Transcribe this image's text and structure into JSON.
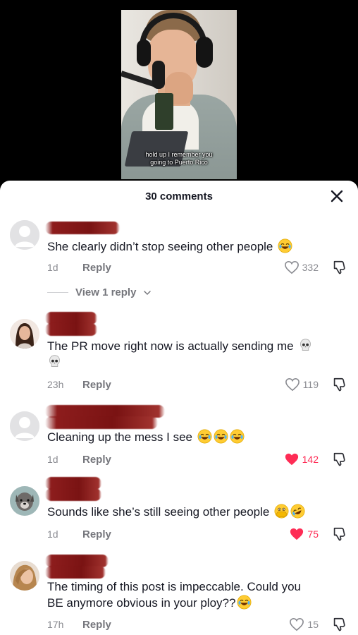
{
  "video": {
    "caption_line1": "hold up I remember you",
    "caption_line2": "going to Puerto Rico"
  },
  "sheet": {
    "comment_count": "30 comments"
  },
  "comments": [
    {
      "text": "She clearly didn’t stop seeing other people",
      "time": "1d",
      "reply_label": "Reply",
      "likes": "332",
      "liked": false,
      "emojis": [
        "joy-emoji"
      ]
    },
    {
      "text": "The PR move right now is actually sending me",
      "time": "23h",
      "reply_label": "Reply",
      "likes": "119",
      "liked": false,
      "emojis": [
        "skull-emoji",
        "skull-emoji"
      ]
    },
    {
      "text": "Cleaning up the mess I see",
      "time": "1d",
      "reply_label": "Reply",
      "likes": "142",
      "liked": true,
      "emojis": [
        "joy-emoji",
        "joy-emoji",
        "joy-emoji"
      ]
    },
    {
      "text": "Sounds like she’s still seeing other people",
      "time": "1d",
      "reply_label": "Reply",
      "likes": "75",
      "liked": true,
      "emojis": [
        "face-with-hand-over-mouth-emoji",
        "rofl-emoji"
      ]
    },
    {
      "text_line1": "The timing of this post is impeccable. Could you",
      "text_line2": "BE anymore obvious in your ploy??",
      "time": "17h",
      "reply_label": "Reply",
      "likes": "15",
      "liked": false,
      "emojis": [
        "joy-emoji"
      ]
    }
  ],
  "replies_toggle": {
    "label": "View 1 reply"
  },
  "colors": {
    "like_active": "#fe2c55",
    "text_primary": "#161823",
    "text_secondary": "#8a8b91"
  }
}
